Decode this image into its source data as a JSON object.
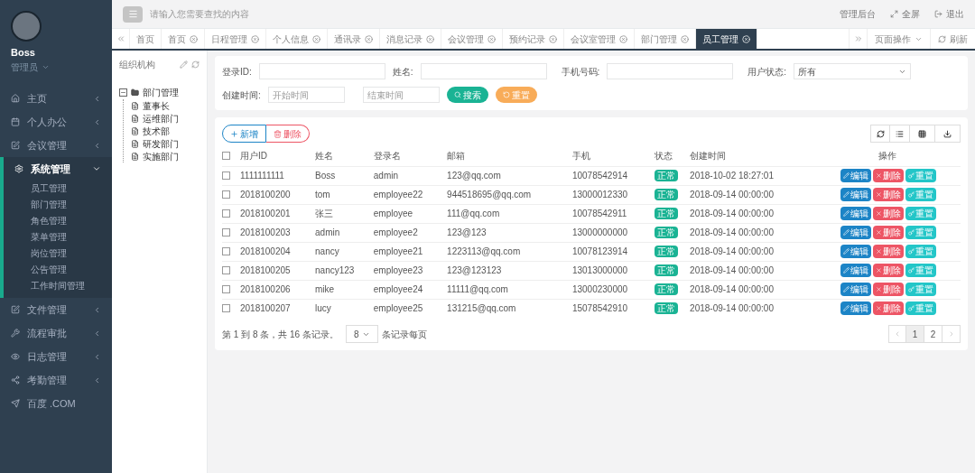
{
  "user": {
    "name": "Boss",
    "role": "管理员"
  },
  "sidebar": {
    "items": [
      {
        "label": "主页",
        "kind": "group",
        "expanded": false
      },
      {
        "label": "个人办公",
        "kind": "group",
        "expanded": false
      },
      {
        "label": "会议管理",
        "kind": "group",
        "expanded": false
      },
      {
        "label": "系统管理",
        "kind": "group",
        "expanded": true,
        "children": [
          {
            "label": "员工管理"
          },
          {
            "label": "部门管理"
          },
          {
            "label": "角色管理"
          },
          {
            "label": "菜单管理"
          },
          {
            "label": "岗位管理"
          },
          {
            "label": "公告管理"
          },
          {
            "label": "工作时间管理"
          }
        ]
      },
      {
        "label": "文件管理",
        "kind": "group",
        "expanded": false
      },
      {
        "label": "流程审批",
        "kind": "group",
        "expanded": false
      },
      {
        "label": "日志管理",
        "kind": "group",
        "expanded": false
      },
      {
        "label": "考勤管理",
        "kind": "group",
        "expanded": false
      },
      {
        "label": "百度 .COM",
        "kind": "link"
      }
    ]
  },
  "topbar": {
    "search_placeholder": "请输入您需要查找的内容",
    "actions": [
      "管理后台",
      "全屏",
      "退出"
    ]
  },
  "tabs": [
    {
      "label": "首页",
      "closable": false,
      "selected": false
    },
    {
      "label": "首页",
      "closable": true,
      "selected": false
    },
    {
      "label": "日程管理",
      "closable": true,
      "selected": false
    },
    {
      "label": "个人信息",
      "closable": true,
      "selected": false
    },
    {
      "label": "通讯录",
      "closable": true,
      "selected": false
    },
    {
      "label": "消息记录",
      "closable": true,
      "selected": false
    },
    {
      "label": "会议管理",
      "closable": true,
      "selected": false
    },
    {
      "label": "预约记录",
      "closable": true,
      "selected": false
    },
    {
      "label": "会议室管理",
      "closable": true,
      "selected": false
    },
    {
      "label": "部门管理",
      "closable": true,
      "selected": false
    },
    {
      "label": "员工管理",
      "closable": true,
      "selected": true
    }
  ],
  "tab_actions": [
    "页面操作",
    "刷新"
  ],
  "tree": {
    "title": "组织机构",
    "root": {
      "label": "部门管理",
      "expanded": true,
      "children": [
        {
          "label": "董事长"
        },
        {
          "label": "运维部门"
        },
        {
          "label": "技术部"
        },
        {
          "label": "研发部门"
        },
        {
          "label": "实施部门"
        }
      ]
    }
  },
  "filters": {
    "login_id": "登录ID:",
    "name": "姓名:",
    "phone": "手机号码:",
    "status_label": "用户状态:",
    "status_value": "所有",
    "created_label": "创建时间:",
    "start_placeholder": "开始时间",
    "end_placeholder": "结束时间",
    "search": "搜索",
    "reset": "重置"
  },
  "toolbar": {
    "add": "新增",
    "delete": "删除"
  },
  "table": {
    "all_checked": false,
    "columns": [
      "用户ID",
      "姓名",
      "登录名",
      "邮箱",
      "手机",
      "状态",
      "创建时间",
      "操作"
    ],
    "rows": [
      {
        "checked": false,
        "cells": [
          "1111111111",
          "Boss",
          "admin",
          "123@qq.com",
          "10078542914"
        ],
        "status": "正常",
        "created": "2018-10-02 18:27:01",
        "actions": [
          "编辑",
          "删除",
          "重置"
        ]
      },
      {
        "checked": false,
        "cells": [
          "2018100200",
          "tom",
          "employee22",
          "944518695@qq.com",
          "13000012330"
        ],
        "status": "正常",
        "created": "2018-09-14 00:00:00",
        "actions": [
          "编辑",
          "删除",
          "重置"
        ]
      },
      {
        "checked": false,
        "cells": [
          "2018100201",
          "张三",
          "employee",
          "111@qq.com",
          "10078542911"
        ],
        "status": "正常",
        "created": "2018-09-14 00:00:00",
        "actions": [
          "编辑",
          "删除",
          "重置"
        ]
      },
      {
        "checked": false,
        "cells": [
          "2018100203",
          "admin",
          "employee2",
          "123@123",
          "13000000000"
        ],
        "status": "正常",
        "created": "2018-09-14 00:00:00",
        "actions": [
          "编辑",
          "删除",
          "重置"
        ]
      },
      {
        "checked": false,
        "cells": [
          "2018100204",
          "nancy",
          "employee21",
          "1223113@qq.com",
          "10078123914"
        ],
        "status": "正常",
        "created": "2018-09-14 00:00:00",
        "actions": [
          "编辑",
          "删除",
          "重置"
        ]
      },
      {
        "checked": false,
        "cells": [
          "2018100205",
          "nancy123",
          "employee23",
          "123@123123",
          "13013000000"
        ],
        "status": "正常",
        "created": "2018-09-14 00:00:00",
        "actions": [
          "编辑",
          "删除",
          "重置"
        ]
      },
      {
        "checked": false,
        "cells": [
          "2018100206",
          "mike",
          "employee24",
          "11111@qq.com",
          "13000230000"
        ],
        "status": "正常",
        "created": "2018-09-14 00:00:00",
        "actions": [
          "编辑",
          "删除",
          "重置"
        ]
      },
      {
        "checked": false,
        "cells": [
          "2018100207",
          "lucy",
          "employee25",
          "131215@qq.com",
          "15078542910"
        ],
        "status": "正常",
        "created": "2018-09-14 00:00:00",
        "actions": [
          "编辑",
          "删除",
          "重置"
        ]
      }
    ]
  },
  "pagination": {
    "summary": "第 1 到 8 条，共 16 条记录。",
    "page_size": "8",
    "page_size_suffix": "条记录每页",
    "pages": [
      {
        "label": "1",
        "selected": true
      },
      {
        "label": "2",
        "selected": false
      }
    ]
  }
}
